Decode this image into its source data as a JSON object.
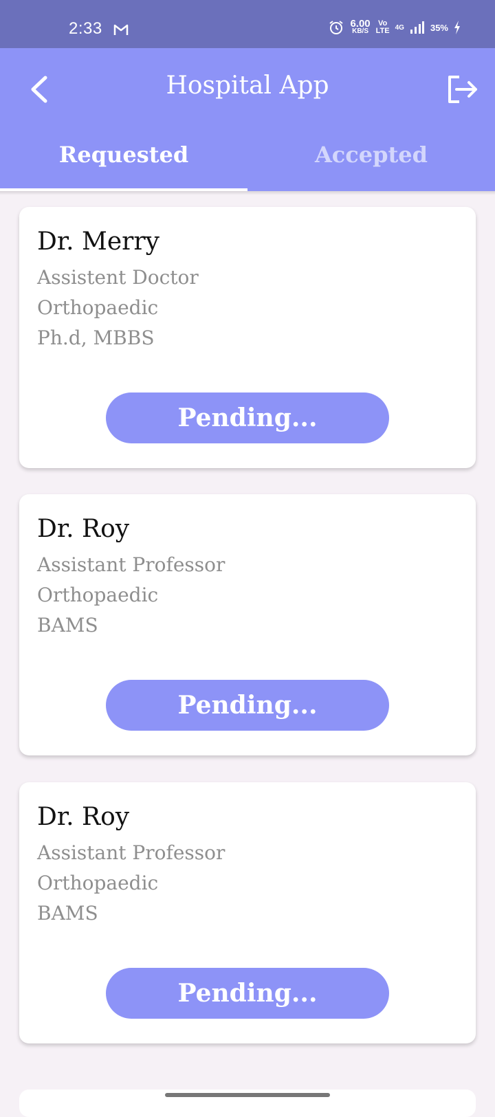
{
  "status_bar": {
    "time": "2:33",
    "net_speed_value": "6.00",
    "net_speed_unit": "KB/S",
    "volte_top": "Vo",
    "volte_bottom": "LTE",
    "network": "4G",
    "battery": "35%",
    "icons": [
      "gmail-icon",
      "alarm-icon",
      "signal-icon",
      "charging-icon"
    ]
  },
  "app_bar": {
    "title": "Hospital App",
    "back_icon": "chevron-left-icon",
    "logout_icon": "logout-icon",
    "color": "#8d93f7"
  },
  "tabs": [
    {
      "label": "Requested",
      "selected": true
    },
    {
      "label": "Accepted",
      "selected": false
    }
  ],
  "cards": [
    {
      "name": "Dr. Merry",
      "designation": "Assistent Doctor",
      "department": "Orthopaedic",
      "qualification": "Ph.d, MBBS",
      "status": "Pending..."
    },
    {
      "name": "Dr. Roy",
      "designation": "Assistant Professor",
      "department": "Orthopaedic",
      "qualification": "BAMS",
      "status": "Pending..."
    },
    {
      "name": "Dr. Roy",
      "designation": "Assistant Professor",
      "department": "Orthopaedic",
      "qualification": "BAMS",
      "status": "Pending..."
    }
  ]
}
